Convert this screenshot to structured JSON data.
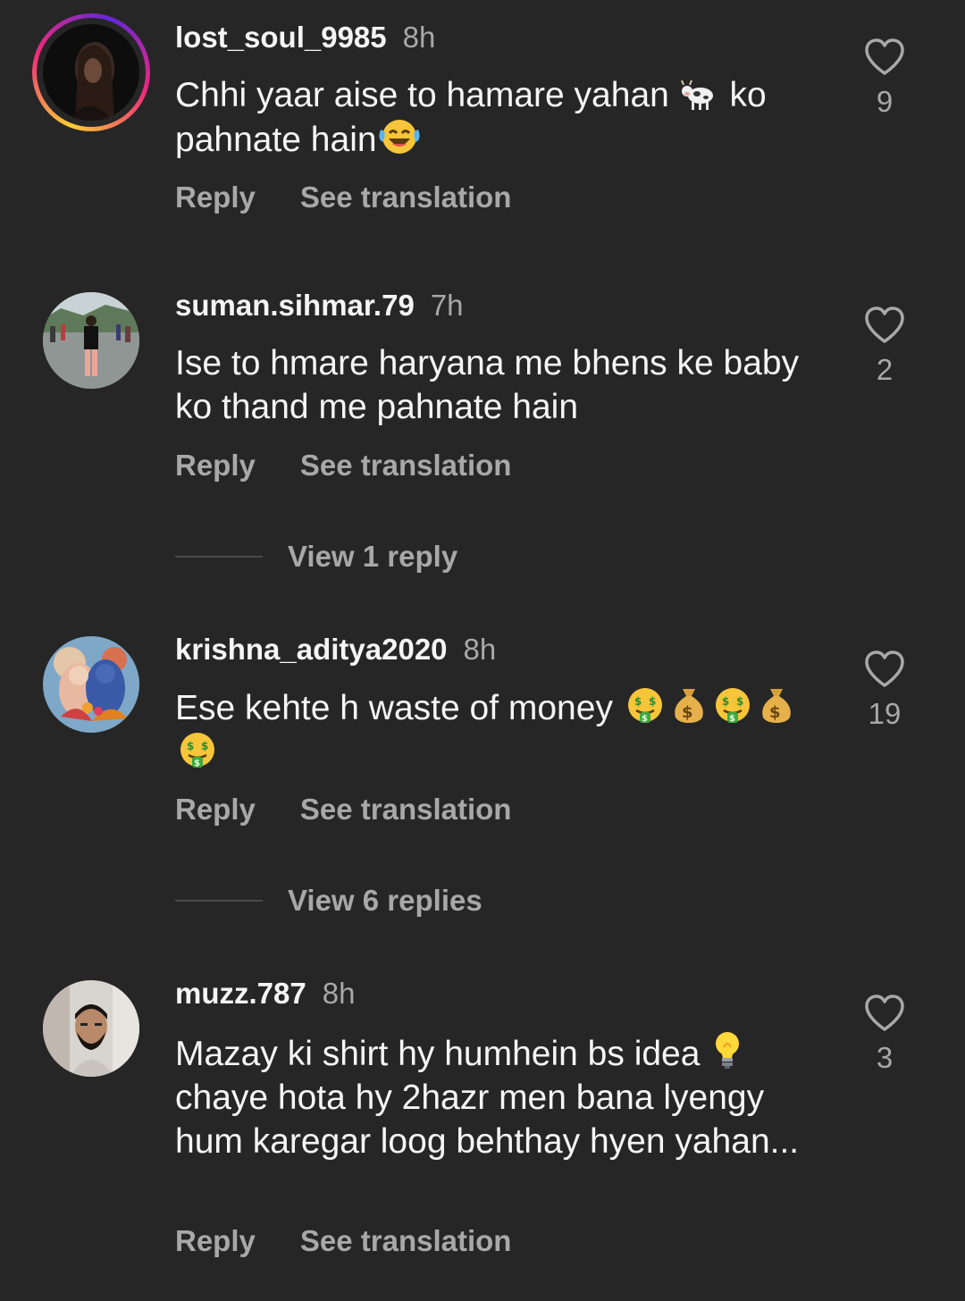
{
  "comments": [
    {
      "username": "lost_soul_9985",
      "time": "8h",
      "text_parts": [
        "Chhi yaar aise to hamare yahan ",
        " ko pahnate hain"
      ],
      "emojis": [
        "cow-emoji",
        "laughing-tears-emoji"
      ],
      "reply": "Reply",
      "see_translation": "See translation",
      "likes": "9",
      "has_story_ring": true
    },
    {
      "username": "suman.sihmar.79",
      "time": "7h",
      "text": "Ise to hmare haryana me bhens ke baby ko thand me pahnate hain",
      "reply": "Reply",
      "see_translation": "See translation",
      "likes": "2",
      "view_replies": "View 1 reply"
    },
    {
      "username": "krishna_aditya2020",
      "time": "8h",
      "text": "Ese kehte h waste of money ",
      "emojis": [
        "money-mouth-emoji",
        "money-bag-emoji",
        "money-mouth-emoji",
        "money-bag-emoji",
        "money-mouth-emoji"
      ],
      "reply": "Reply",
      "see_translation": "See translation",
      "likes": "19",
      "view_replies": "View 6 replies"
    },
    {
      "username": "muzz.787",
      "time": "8h",
      "text_parts": [
        "Mazay ki shirt hy humhein bs idea ",
        " chaye hota hy 2hazr men bana lyengy hum karegar loog behthay hyen yahan..."
      ],
      "emojis": [
        "light-bulb-emoji"
      ],
      "reply": "Reply",
      "see_translation": "See translation",
      "likes": "3"
    }
  ],
  "colors": {
    "background": "#262626",
    "primary_text": "#f5f5f5",
    "secondary_text": "#a8a8a8"
  }
}
